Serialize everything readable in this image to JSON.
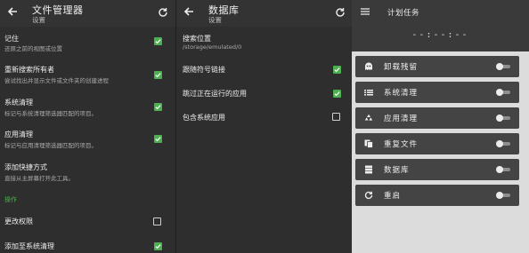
{
  "panel1": {
    "title": "文件管理器",
    "subtitle": "设置",
    "items": [
      {
        "title": "记住",
        "desc": "还原之前的视图或位置",
        "checked": true
      },
      {
        "title": "重新搜索所有者",
        "desc": "尝试找出并显示文件或文件夹的创建进程",
        "checked": true
      },
      {
        "title": "系统清理",
        "desc": "标记与系统清理筛选器匹配的项目。",
        "checked": true
      },
      {
        "title": "应用清理",
        "desc": "标记与应用清理筛选器匹配的项目。",
        "checked": true
      },
      {
        "title": "添加快捷方式",
        "desc": "直接从主屏幕打开此工具。"
      }
    ],
    "section": "操作",
    "actions": [
      {
        "title": "更改权限",
        "checked": false
      },
      {
        "title": "添加至系统清理",
        "checked": true
      }
    ]
  },
  "panel2": {
    "title": "数据库",
    "subtitle": "设置",
    "search_title": "搜索位置",
    "search_path": "/storage/emulated/0",
    "items": [
      {
        "title": "跟随符号链接",
        "checked": true
      },
      {
        "title": "跳过正在运行的应用",
        "checked": true
      },
      {
        "title": "包含系统应用",
        "checked": false
      }
    ]
  },
  "panel3": {
    "title": "计划任务",
    "time": "--:--:--",
    "tasks": [
      {
        "label": "卸载残留",
        "icon": "ghost-icon",
        "enabled": false
      },
      {
        "label": "系统清理",
        "icon": "list-icon",
        "enabled": false
      },
      {
        "label": "应用清理",
        "icon": "recycle-icon",
        "enabled": false
      },
      {
        "label": "重复文件",
        "icon": "copy-icon",
        "enabled": false
      },
      {
        "label": "数据库",
        "icon": "database-icon",
        "enabled": false
      },
      {
        "label": "重启",
        "icon": "restart-icon",
        "enabled": false
      }
    ]
  },
  "colors": {
    "accent": "#4caf50",
    "panel_dark": "#2e2e2e",
    "panel_light": "#dcdcdc"
  }
}
